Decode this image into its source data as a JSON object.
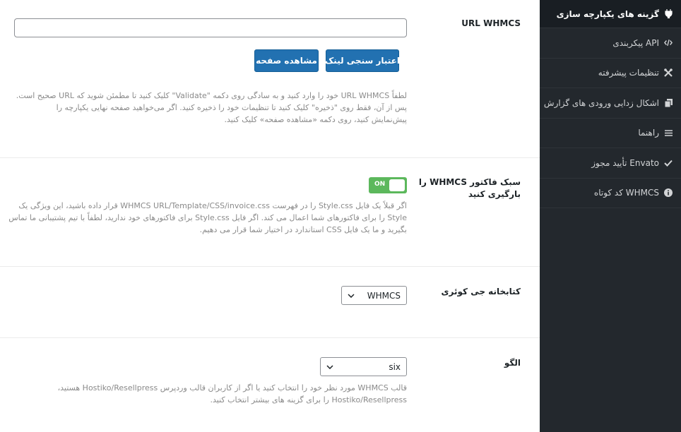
{
  "sidebar": {
    "items": [
      {
        "label": "گزینه های یکپارچه سازی",
        "icon": "plug-icon"
      },
      {
        "label": "پیکربندی API",
        "icon": "code-icon"
      },
      {
        "label": "تنظیمات پیشرفته",
        "icon": "wrench-icon"
      },
      {
        "label": "اشکال زدایی ورودی های گزارش",
        "icon": "copy-icon"
      },
      {
        "label": "راهنما",
        "icon": "menu-icon"
      },
      {
        "label": "تأیید مجوز Envato",
        "icon": "check-icon"
      },
      {
        "label": "کد کوتاه WHMCS",
        "icon": "info-icon"
      }
    ]
  },
  "url_section": {
    "label": "URL WHMCS",
    "input_value": "",
    "validate_button": "اعتبار سنجی لینک",
    "view_button": "مشاهده صفحه",
    "description": [
      "لطفاً URL WHMCS خود را وارد کنید و به سادگی روی دکمه \"Validate\" کلیک کنید تا مطمئن شوید که URL صحیح است.",
      "پس از آن، فقط روی \"ذخیره\" کلیک کنید تا تنظیمات خود را ذخیره کنید. اگر می‌خواهید صفحه نهایی یکپارچه را",
      "پیش‌نمایش کنید، روی دکمه «مشاهده صفحه» کلیک کنید."
    ]
  },
  "invoice_section": {
    "label_line1": "سبک فاکتور WHMCS را",
    "label_line2": "بارگیری کنید",
    "toggle_state": "ON",
    "description": [
      "اگر قبلاً یک فایل Style.css را در فهرست WHMCS URL/Template/CSS/invoice.css قرار داده باشید، این ویژگی یک",
      "Style را برای فاکتورهای شما اعمال می کند. اگر فایل Style.css برای فاکتورهای خود ندارید، لطفاً با تیم پشتیبانی ما تماس",
      "بگیرید و ما یک فایل CSS استاندارد در اختیار شما قرار می دهیم."
    ]
  },
  "jquery_section": {
    "label": "کتابخانه جی کوئری",
    "selected": "WHMCS"
  },
  "template_section": {
    "label": "الگو",
    "selected": "six",
    "description": [
      "قالب WHMCS مورد نظر خود را انتخاب کنید یا اگر از کاربران قالب وردپرس Hostiko/Resellpress هستید،",
      "Hostiko/Resellpress را برای گزینه های بیشتر انتخاب کنید."
    ]
  },
  "colors": {
    "sidebar_bg": "#23282d",
    "primary_button": "#2271b1",
    "toggle_on": "#5cb85c"
  }
}
